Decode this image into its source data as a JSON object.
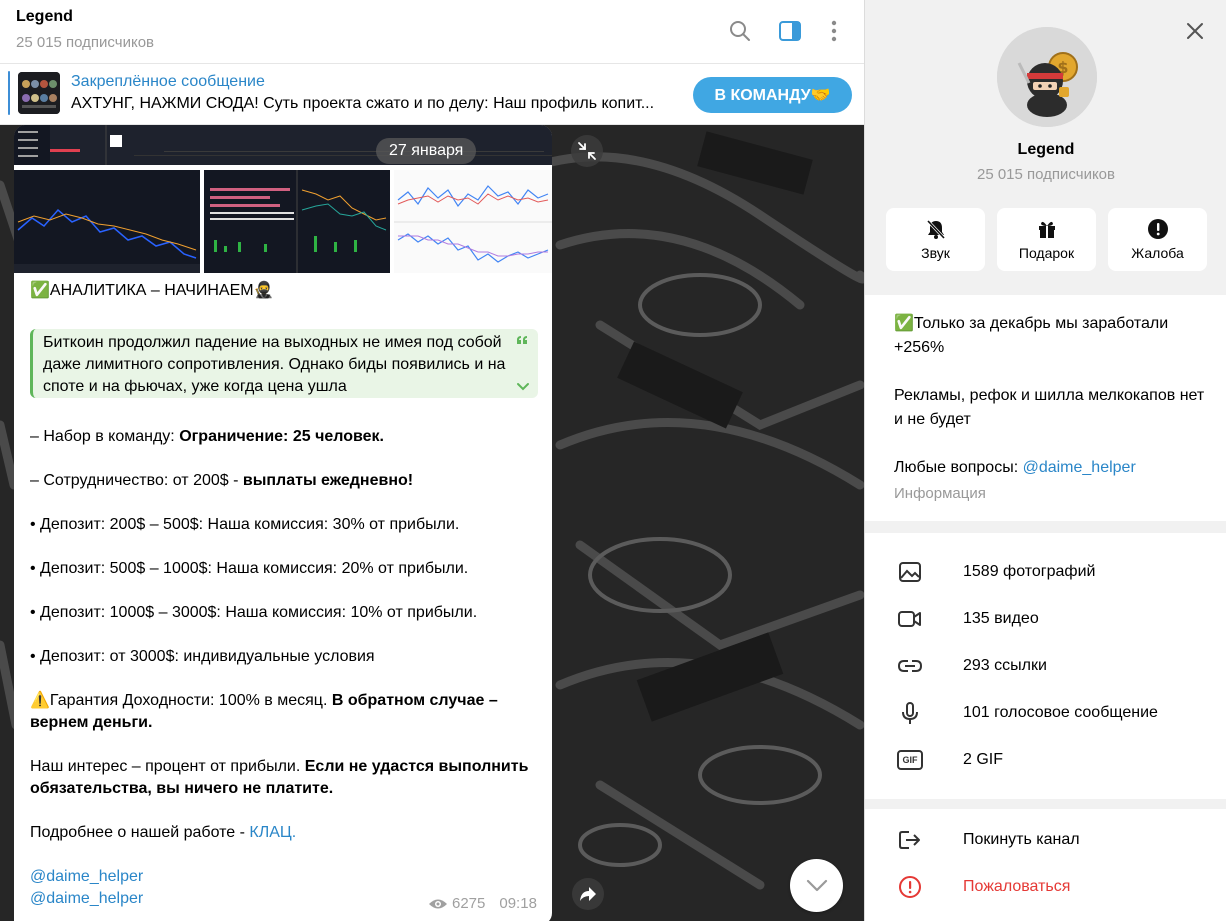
{
  "header": {
    "title": "Legend",
    "subscribers": "25 015 подписчиков"
  },
  "pinned": {
    "title": "Закреплённое сообщение",
    "text": "АХТУНГ, НАЖМИ СЮДА!  Суть проекта сжато и по делу: Наш профиль копит...",
    "button": "В КОМАНДУ🤝"
  },
  "message": {
    "date": "27 января",
    "heading": "✅АНАЛИТИКА – НАЧИНАЕМ🥷",
    "quote": "Биткоин продолжил падение на выходных не имея под собой даже лимитного сопротивления. Однако биды появились и на споте и на фьючах, уже когда цена ушла",
    "team_prefix": "– Набор в команду: ",
    "team_bold": "Ограничение: 25 человек.",
    "coop_prefix": "– Сотрудничество: от 200$ - ",
    "coop_bold": "выплаты ежедневно!",
    "dep1": "• Депозит: 200$ – 500$: Наша комиссия: 30% от прибыли.",
    "dep2": "• Депозит: 500$ – 1000$: Наша комиссия: 20% от прибыли.",
    "dep3": "• Депозит: 1000$ – 3000$: Наша комиссия: 10% от прибыли.",
    "dep4": "• Депозит: от 3000$: индивидуальные условия",
    "guarantee_prefix": "⚠️Гарантия Доходности: 100% в месяц. ",
    "guarantee_bold": "В обратном случае – вернем деньги.",
    "interest_prefix": "Наш интерес – процент от прибыли. ",
    "interest_bold": "Если не удастся выполнить обязательства, вы ничего не платите.",
    "more_prefix": "Подробнее о нашей работе - ",
    "more_link": "КЛАЦ.",
    "handle1": "@daime_helper",
    "handle2": "@daime_helper",
    "views": "6275",
    "time": "09:18"
  },
  "panel": {
    "name": "Legend",
    "subscribers": "25 015 подписчиков",
    "actions": [
      {
        "label": "Звук",
        "icon": "bell-off-icon"
      },
      {
        "label": "Подарок",
        "icon": "gift-icon"
      },
      {
        "label": "Жалоба",
        "icon": "alert-icon"
      }
    ],
    "about_line1": "✅Только за декабрь мы заработали +256%",
    "about_line2": "Рекламы, рефок и шилла мелкокапов нет и не будет",
    "about_q_prefix": "Любые вопросы: ",
    "about_q_link": "@daime_helper",
    "about_hint": "Информация",
    "media": [
      {
        "label": "1589 фотографий",
        "icon": "photo-icon"
      },
      {
        "label": "135 видео",
        "icon": "video-icon"
      },
      {
        "label": "293 ссылки",
        "icon": "link-icon"
      },
      {
        "label": "101 голосовое сообщение",
        "icon": "microphone-icon"
      },
      {
        "label": "2 GIF",
        "icon": "gif-icon"
      }
    ],
    "gif_badge": "GIF",
    "leave": "Покинуть канал",
    "report": "Пожаловаться"
  },
  "colors": {
    "accent": "#40a7e3",
    "link": "#2a86c8",
    "danger": "#e53935",
    "quote_bg": "#e9f5e6",
    "quote_border": "#5fb65a"
  }
}
